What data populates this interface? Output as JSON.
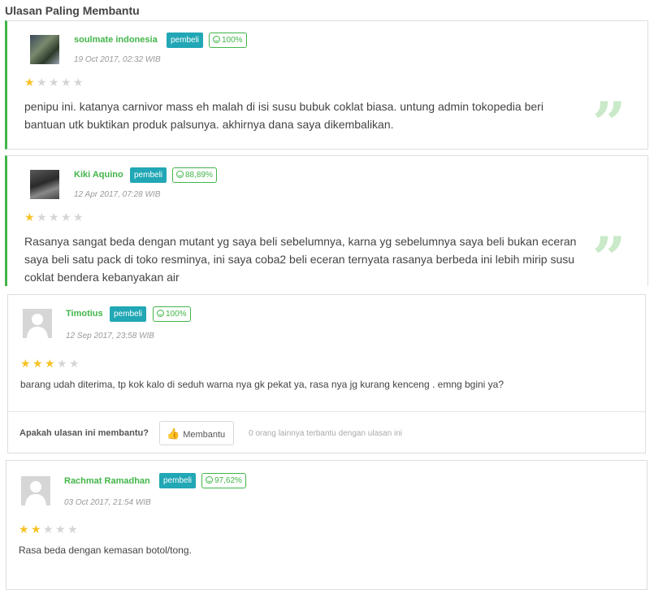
{
  "section": {
    "title": "Ulasan Paling Membantu"
  },
  "reviews": [
    {
      "name": "soulmate indonesia",
      "buyer_label": "pembeli",
      "reputation": "100%",
      "date": "19 Oct 2017, 02:32 WIB",
      "rating": 1,
      "text": "penipu ini. katanya carnivor mass eh malah di isi susu bubuk coklat biasa. untung admin tokopedia beri bantuan utk buktikan produk palsunya. akhirnya dana saya dikembalikan."
    },
    {
      "name": "Kiki Aquino",
      "buyer_label": "pembeli",
      "reputation": "88,89%",
      "date": "12 Apr 2017, 07:28 WIB",
      "rating": 1,
      "text": "Rasanya sangat beda dengan mutant yg saya beli sebelumnya, karna yg sebelumnya saya beli bukan eceran saya beli satu pack di toko resminya, ini saya coba2 beli eceran ternyata rasanya berbeda ini lebih mirip susu coklat bendera kebanyakan air"
    },
    {
      "name": "Timotius",
      "buyer_label": "pembeli",
      "reputation": "100%",
      "date": "12 Sep 2017, 23:58 WIB",
      "rating": 3,
      "text": "barang udah diterima, tp kok kalo di seduh warna nya gk pekat ya, rasa nya jg kurang kenceng . emng bgini ya?",
      "helpful_question": "Apakah ulasan ini membantu?",
      "helpful_button": "Membantu",
      "helpful_count": "0 orang lainnya terbantu dengan ulasan ini"
    },
    {
      "name": "Rachmat Ramadhan",
      "buyer_label": "pembeli",
      "reputation": "97,62%",
      "date": "03 Oct 2017, 21:54 WIB",
      "rating": 2,
      "text": "Rasa beda dengan kemasan botol/tong."
    }
  ],
  "icons": {
    "quote": "quote-icon",
    "thumb": "thumbs-up-icon",
    "smile": "smile-icon",
    "avatar_placeholder": "user-placeholder-icon"
  },
  "colors": {
    "accent": "#42b549",
    "buyer_badge": "#21a7b5",
    "star": "#f7c325"
  }
}
